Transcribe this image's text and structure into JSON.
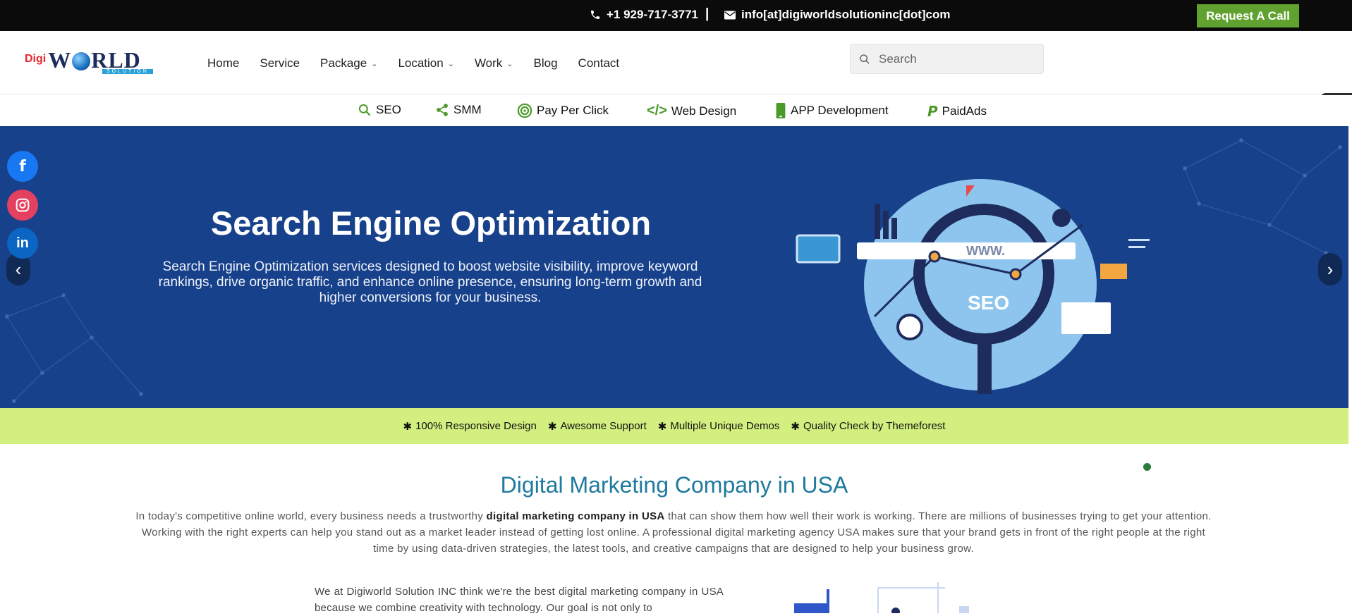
{
  "topbar": {
    "phone": "+1 929-717-3771",
    "separator": "|",
    "email": "info[at]digiworldsolutioninc[dot]com",
    "request_button": "Request A Call"
  },
  "logo": {
    "digi": "Digi",
    "world_pre": "W",
    "world_post": "RLD",
    "sub": "SOLUTION"
  },
  "nav": {
    "home": "Home",
    "service": "Service",
    "package": "Package",
    "location": "Location",
    "work": "Work",
    "blog": "Blog",
    "contact": "Contact"
  },
  "search": {
    "placeholder": "Search"
  },
  "services": {
    "seo": "SEO",
    "smm": "SMM",
    "ppc": "Pay Per Click",
    "web": "Web Design",
    "app": "APP Development",
    "paid": "PaidAds"
  },
  "hero": {
    "title": "Search Engine Optimization",
    "description": "Search Engine Optimization services designed to boost website visibility, improve keyword rankings, drive organic traffic, and enhance online presence, ensuring long-term growth and higher conversions for your business.",
    "prev": "‹",
    "next": "›",
    "illus_www": "WWW.",
    "illus_seo": "SEO"
  },
  "social": {
    "facebook": "f",
    "linkedin": "in"
  },
  "features": {
    "f1": "100% Responsive Design",
    "f2": "Awesome Support",
    "f3": "Multiple Unique Demos",
    "f4": "Quality Check by Themeforest"
  },
  "content": {
    "heading": "Digital Marketing Company in USA",
    "intro_pre": "In today's competitive online world, every business needs a trustworthy ",
    "intro_bold": "digital marketing company in USA",
    "intro_post": " that can show them how well their work is working. There are millions of businesses trying to get your attention. Working with the right experts can help you stand out as a market leader instead of getting lost online. A professional digital marketing agency USA makes sure that your brand gets in front of the right people at the right time by using data-driven strategies, the latest tools, and creative campaigns that are designed to help your business grow.",
    "para2": "We at Digiworld Solution INC think we're the best digital marketing company in USA because we combine creativity with technology. Our goal is not only to"
  },
  "colors": {
    "accent_green": "#61a12f",
    "hero_blue": "#17418a",
    "feature_lime": "#d3ef7f",
    "heading_teal": "#1e7a9e"
  }
}
